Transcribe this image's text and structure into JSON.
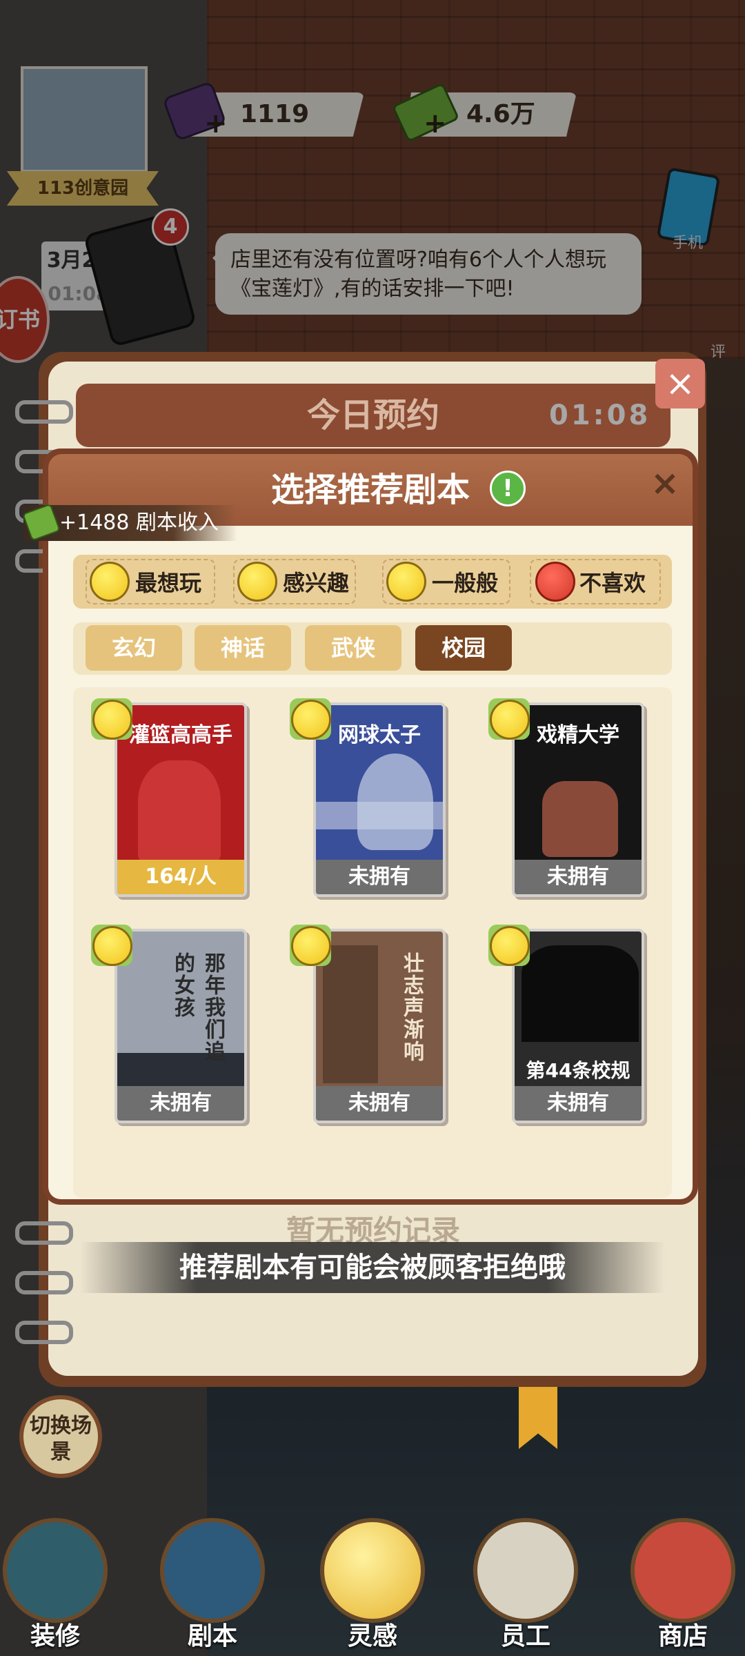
{
  "hud": {
    "gems": "1119",
    "cash": "4.6万",
    "store_name": "113创意园",
    "date": "3月24",
    "time_small": "01:08",
    "phone_badge": "4",
    "side_phone_label": "手机",
    "side_label_2": "评",
    "left_button": "订书"
  },
  "speech": {
    "text": "店里还有没有位置呀?咱有6个人个人想玩《宝莲灯》,有的话安排一下吧!"
  },
  "notebook": {
    "title": "今日预约",
    "time": "01:08",
    "empty_text": "暂无预约记录",
    "close": "×"
  },
  "modal": {
    "title": "选择推荐剧本",
    "info": "!",
    "close": "×",
    "income_label": "+1488 剧本收入",
    "preferences": [
      {
        "label": "最想玩",
        "face": "laughing-face-icon",
        "color": "#f2c41c"
      },
      {
        "label": "感兴趣",
        "face": "smiling-face-icon",
        "color": "#f2c41c"
      },
      {
        "label": "一般般",
        "face": "neutral-face-icon",
        "color": "#f2c41c"
      },
      {
        "label": "不喜欢",
        "face": "angry-face-icon",
        "color": "#d23a2c"
      }
    ],
    "tabs": [
      "玄幻",
      "神话",
      "武侠",
      "校园"
    ],
    "active_tab": "校园",
    "scripts": [
      {
        "title": "灌篮高高手",
        "status": "164/人",
        "owned": true,
        "color": "#b21d20"
      },
      {
        "title": "网球太子",
        "status": "未拥有",
        "owned": false,
        "color": "#3a4f9a"
      },
      {
        "title": "戏精大学",
        "status": "未拥有",
        "owned": false,
        "color": "#151515"
      },
      {
        "title": "那年我们追的女孩",
        "status": "未拥有",
        "owned": false,
        "color": "#9ba2ae"
      },
      {
        "title": "壮志声渐响",
        "status": "未拥有",
        "owned": false,
        "color": "#7d5a45"
      },
      {
        "title": "第44条校规",
        "status": "未拥有",
        "owned": false,
        "color": "#2b2b2b"
      }
    ]
  },
  "toast": {
    "text": "推荐剧本有可能会被顾客拒绝哦"
  },
  "side_buttons": {
    "switch_scene": "切换场景"
  },
  "nav": [
    {
      "label": "装修",
      "icon": "house-icon"
    },
    {
      "label": "剧本",
      "icon": "book-icon"
    },
    {
      "label": "灵感",
      "icon": "lightbulb-icon"
    },
    {
      "label": "员工",
      "icon": "badge-icon"
    },
    {
      "label": "商店",
      "icon": "shop-icon"
    }
  ]
}
